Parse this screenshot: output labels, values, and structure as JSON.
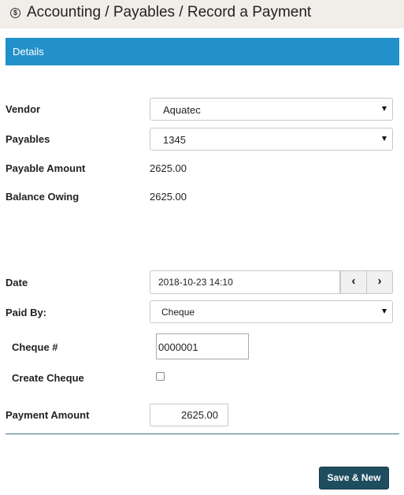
{
  "header": {
    "icon": "dollar-circle-icon",
    "title": "Accounting / Payables / Record a Payment"
  },
  "panel": {
    "title": "Details"
  },
  "form": {
    "vendor": {
      "label": "Vendor",
      "value": "Aquatec"
    },
    "payables": {
      "label": "Payables",
      "value": "1345"
    },
    "payable_amount": {
      "label": "Payable Amount",
      "value": "2625.00"
    },
    "balance_owing": {
      "label": "Balance Owing",
      "value": "2625.00"
    },
    "date": {
      "label": "Date",
      "value": "2018-10-23 14:10",
      "prev_icon": "chevron-left-icon",
      "next_icon": "chevron-right-icon"
    },
    "paid_by": {
      "label": "Paid By:",
      "value": "Cheque"
    },
    "cheque_number": {
      "label": "Cheque #",
      "value": "0000001"
    },
    "create_cheque": {
      "label": "Create Cheque",
      "checked": false
    },
    "payment_amount": {
      "label": "Payment Amount",
      "value": "2625.00"
    }
  },
  "actions": {
    "save_new_label": "Save & New"
  }
}
